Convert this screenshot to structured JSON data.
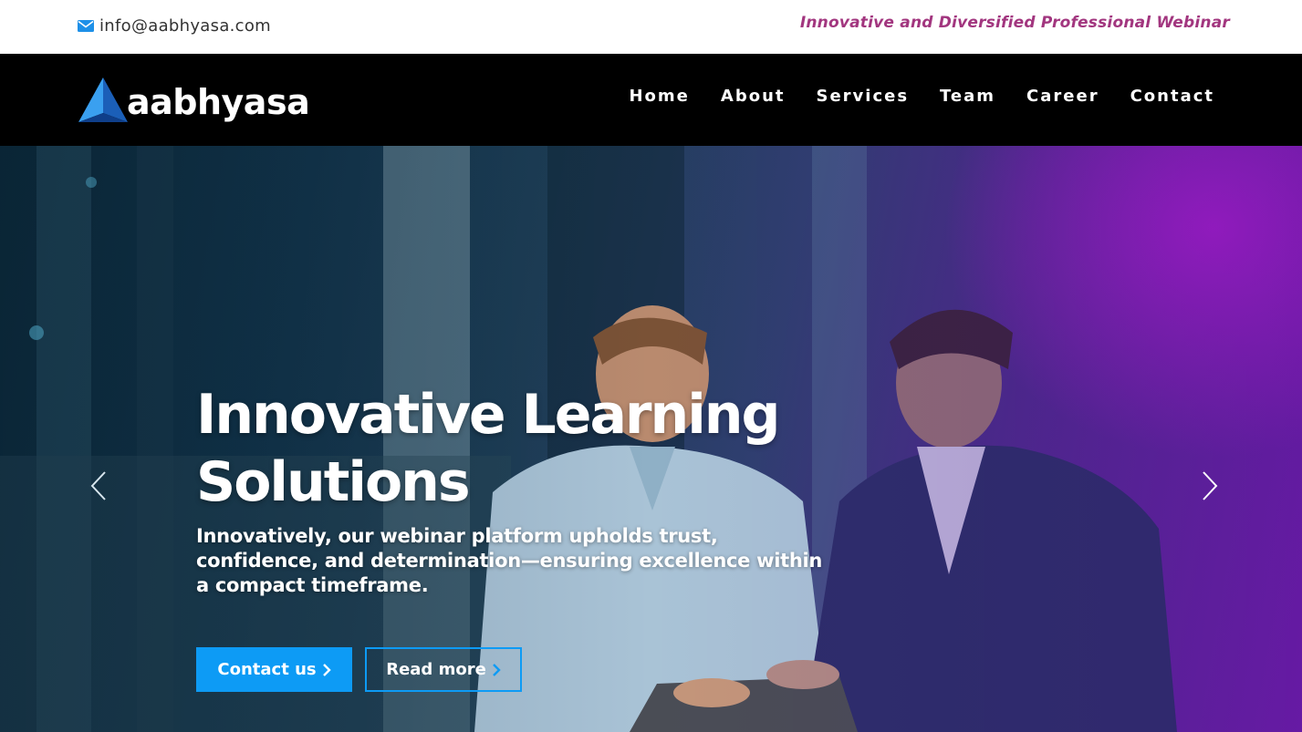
{
  "topbar": {
    "email": "info@aabhyasa.com",
    "email_icon": "envelope-icon",
    "tagline": "Innovative and Diversified Professional Webinar"
  },
  "brand": {
    "name": "aabhyasa",
    "logo_icon": "triangle-logo-icon"
  },
  "nav": {
    "items": [
      {
        "label": "Home"
      },
      {
        "label": "About"
      },
      {
        "label": "Services"
      },
      {
        "label": "Team"
      },
      {
        "label": "Career"
      },
      {
        "label": "Contact"
      }
    ]
  },
  "hero": {
    "title_line1": "Innovative Learning",
    "title_line2": "Solutions",
    "subtitle": "Innovatively, our webinar platform upholds trust, confidence, and determination—ensuring excellence within a compact timeframe.",
    "contact_button": "Contact us",
    "read_button": "Read more",
    "prev_icon": "chevron-left-icon",
    "next_icon": "chevron-right-icon"
  },
  "colors": {
    "accent": "#0d9bf5",
    "tagline": "#a2367f",
    "nav_bg": "#000000",
    "topbar_bg": "#ffffff"
  }
}
